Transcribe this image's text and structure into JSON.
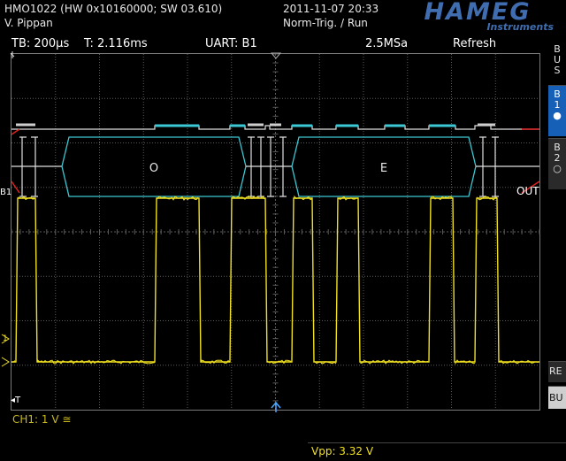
{
  "header": {
    "model": "HMO1022 (HW 0x10160000; SW 03.610)",
    "user": "V. Pippan",
    "datetime": "2011-11-07 20:33",
    "trigger_state": "Norm-Trig. / Run",
    "logo": "HAMEG",
    "logo_sub": "Instruments"
  },
  "status_bar": {
    "timebase": "TB: 200µs",
    "trigger_time": "T: 2.116ms",
    "bus_mode": "UART: B1",
    "sample_rate": "2.5MSa",
    "acq_mode": "Refresh"
  },
  "side_menu": {
    "bus_label": [
      "B",
      "U",
      "S"
    ],
    "b1": [
      "B",
      "1",
      "●"
    ],
    "b2": [
      "B",
      "2",
      "○"
    ],
    "re_label": "RE",
    "bu_label": "BU"
  },
  "screen": {
    "bus_marker": "B1",
    "bus_out": "OUT",
    "ch1_marker": "1",
    "t_marker": "◂T",
    "decoded_bytes": [
      "O",
      "E"
    ]
  },
  "footer": {
    "ch1_setting": "CH1: 1 V ≅",
    "measurement": "Vpp: 3.32 V"
  },
  "colors": {
    "grid": "#5a5a5a",
    "bus_trace": "#3cc8d4",
    "idle_trace": "#e0e0e0",
    "ch1_trace": "#f0e020",
    "marker_red": "#e02020",
    "logo": "#3f6db0",
    "active_tab": "#1660b8"
  }
}
